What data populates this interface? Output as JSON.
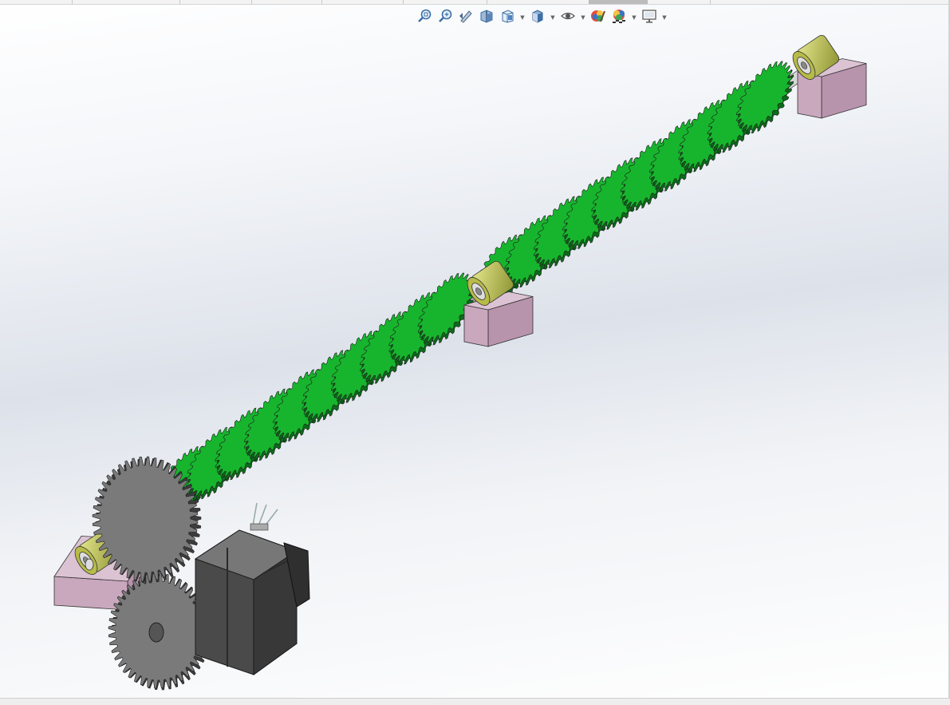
{
  "window": {
    "tab_labels": [
      "",
      "",
      "",
      "",
      "",
      "",
      ""
    ]
  },
  "heads_up_toolbar": {
    "items": [
      {
        "icon": "zoom-to-fit-icon",
        "dropdown": false
      },
      {
        "icon": "zoom-to-area-icon",
        "dropdown": false
      },
      {
        "icon": "previous-view-icon",
        "dropdown": false
      },
      {
        "icon": "section-view-icon",
        "dropdown": false
      },
      {
        "icon": "view-orientation-icon",
        "dropdown": true
      },
      {
        "icon": "display-style-icon",
        "dropdown": true
      },
      {
        "icon": "hide-show-items-icon",
        "dropdown": true
      },
      {
        "icon": "edit-appearance-icon",
        "dropdown": false
      },
      {
        "icon": "apply-scene-icon",
        "dropdown": true
      },
      {
        "icon": "view-settings-icon",
        "dropdown": true
      }
    ]
  },
  "model": {
    "colors": {
      "gear_green": "#17b52d",
      "gear_green_dark": "#0c6b1a",
      "gear_grey": "#7a7a7a",
      "gear_grey_dark": "#3d3d3d",
      "bearing_olive": "#c4c95a",
      "block_mauve": "#c9a8be",
      "motor_dark": "#4a4a4a"
    },
    "green_gear_count": 21
  }
}
